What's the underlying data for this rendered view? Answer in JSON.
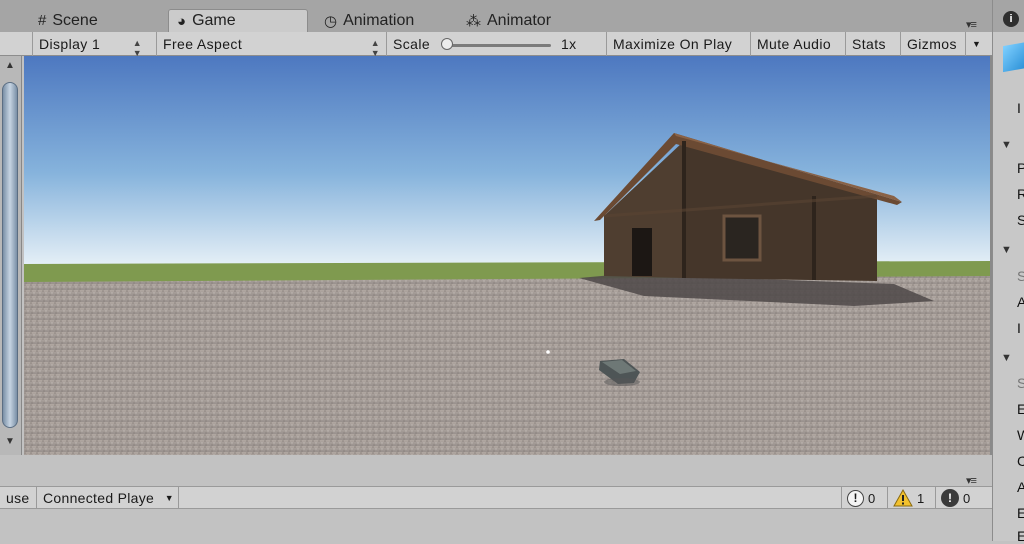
{
  "tabs": [
    {
      "label": "Scene",
      "icon": "grid-icon"
    },
    {
      "label": "Game",
      "icon": "pacman-icon"
    },
    {
      "label": "Animation",
      "icon": "clock-icon"
    },
    {
      "label": "Animator",
      "icon": "nodes-icon"
    }
  ],
  "game_toolbar": {
    "display": "Display 1",
    "aspect": "Free Aspect",
    "scale_label": "Scale",
    "scale_value": "1x",
    "scale_fraction": 0.0,
    "maximize_on_play": "Maximize On Play",
    "mute_audio": "Mute Audio",
    "stats": "Stats",
    "gizmos": "Gizmos"
  },
  "console_toolbar": {
    "pause_partial": "use",
    "connected_player": "Connected Playe",
    "info_count": "0",
    "warning_count": "1",
    "error_count": "0"
  },
  "inspector_letters": [
    "P",
    "R",
    "S",
    "S",
    "A",
    "I",
    "S",
    "E",
    "W",
    "C",
    "A",
    "E",
    "E"
  ],
  "colors": {
    "sky_top": "#4d78c0",
    "sky_horizon": "#e8f1f7",
    "grass": "#7f9a4f",
    "ground": "#a49a93",
    "house_wall": "#4a3a2d",
    "warning": "#f2c12e"
  }
}
